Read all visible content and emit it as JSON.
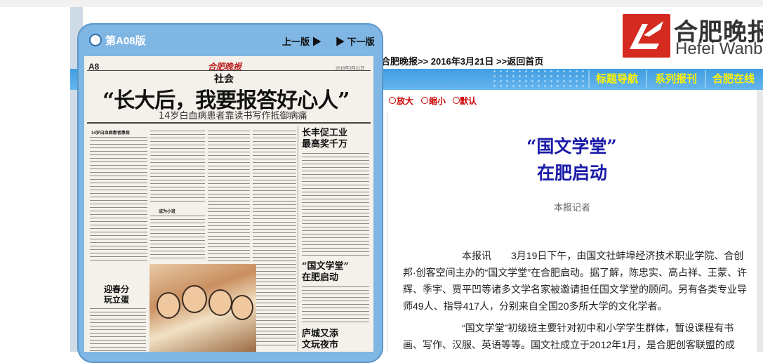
{
  "site": {
    "logo_cn": "合肥晚报",
    "logo_en": "Hefei Wanbao",
    "breadcrumb": "合肥晚报>> 2016年3月21日 >>返回首页"
  },
  "nav": {
    "items": [
      {
        "label": "标题导航"
      },
      {
        "label": "系列报刊"
      },
      {
        "label": "合肥在线"
      }
    ]
  },
  "edition": {
    "label": "第A08版",
    "prev": "上一版",
    "next": "下一版"
  },
  "newspaper_page": {
    "page_number": "A8",
    "masthead": "合肥晚报",
    "date_line": "2016年3月21日",
    "section": "社会",
    "headline": "“长大后，我要报答好心人”",
    "subheadline": "14岁白血病患者靠读书写作抵御病痛",
    "story1_heading": "14岁白血病患者患病",
    "story2_heading": "成为小班",
    "side1_heading_l1": "长丰促工业",
    "side1_heading_l2": "最高奖千万",
    "side2_heading_l1": "“国文学堂”",
    "side2_heading_l2": "在肥启动",
    "side3_heading_l1": "迎春分",
    "side3_heading_l2": "玩立蛋",
    "side4_heading_l1": "庐城又添",
    "side4_heading_l2": "文玩夜市"
  },
  "tools": {
    "zoom_in": "放大",
    "zoom_out": "缩小",
    "default": "默认"
  },
  "article": {
    "title_line1": "“国文学堂”",
    "title_line2": "在肥启动",
    "byline": "本报记者",
    "paragraph1": "本报讯　　3月19日下午，由国文社蚌埠经济技术职业学院、合创邦·创客空间主办的“国文学堂”在合肥启动。据了解，陈忠实、高占祥、王蒙、许辉、季宇、贾平凹等诸多文学名家被邀请担任国文学堂的顾问。另有各类专业导师49人、指导417人，分别来自全国20多所大学的文化学者。",
    "paragraph2": "“国文学堂”初级班主要针对初中和小学学生群体，暂设课程有书画、写作、汉服、英语等等。国文社成立于2012年1月，是合肥创客联盟的成"
  },
  "colors": {
    "nav_bg": "#4aa6e6",
    "nav_text": "#fff200",
    "panel_bg": "#7fb6e4",
    "title_blue": "#1a1aa8",
    "tool_red": "#cc0000",
    "logo_red": "#d42a1f"
  }
}
